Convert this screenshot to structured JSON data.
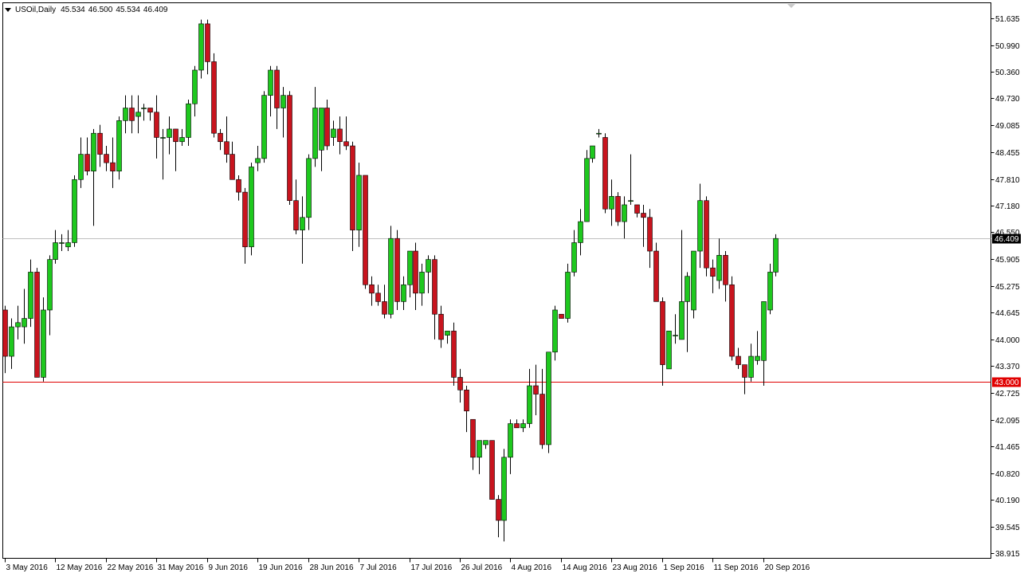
{
  "header": {
    "symbol": "USOil,Daily",
    "open": "45.534",
    "high": "46.500",
    "low": "45.534",
    "close": "46.409"
  },
  "colors": {
    "bull": "#1ec81e",
    "bear": "#c8141e",
    "wick": "#000000",
    "support_line": "#e00000",
    "last_price_line": "#c0c0c0",
    "label_bg": "#000000",
    "support_label_bg": "#e00000"
  },
  "chart_data": {
    "type": "candlestick",
    "ylim": [
      38.8,
      52.0
    ],
    "y_ticks": [
      "51.635",
      "50.990",
      "50.360",
      "49.730",
      "49.085",
      "48.455",
      "47.810",
      "47.180",
      "46.550",
      "45.905",
      "45.275",
      "44.645",
      "44.000",
      "43.370",
      "42.725",
      "42.095",
      "41.465",
      "40.820",
      "40.190",
      "39.545",
      "38.915"
    ],
    "x_ticks": [
      "3 May 2016",
      "12 May 2016",
      "22 May 2016",
      "31 May 2016",
      "9 Jun 2016",
      "19 Jun 2016",
      "28 Jun 2016",
      "7 Jul 2016",
      "17 Jul 2016",
      "26 Jul 2016",
      "4 Aug 2016",
      "14 Aug 2016",
      "23 Aug 2016",
      "1 Sep 2016",
      "11 Sep 2016",
      "20 Sep 2016"
    ],
    "current_price": "46.409",
    "support_level": "43.000",
    "candles": [
      {
        "o": 44.7,
        "h": 44.8,
        "l": 43.2,
        "c": 43.6
      },
      {
        "o": 43.6,
        "h": 44.5,
        "l": 43.3,
        "c": 44.3
      },
      {
        "o": 44.3,
        "h": 44.8,
        "l": 44.0,
        "c": 44.4
      },
      {
        "o": 44.3,
        "h": 45.2,
        "l": 43.9,
        "c": 44.5
      },
      {
        "o": 44.5,
        "h": 45.9,
        "l": 44.3,
        "c": 45.6
      },
      {
        "o": 45.6,
        "h": 45.7,
        "l": 43.1,
        "c": 43.1
      },
      {
        "o": 43.1,
        "h": 45.0,
        "l": 43.0,
        "c": 44.7
      },
      {
        "o": 44.7,
        "h": 46.0,
        "l": 44.1,
        "c": 45.9
      },
      {
        "o": 45.9,
        "h": 46.6,
        "l": 45.8,
        "c": 46.3
      },
      {
        "o": 46.3,
        "h": 46.5,
        "l": 46.1,
        "c": 46.3
      },
      {
        "o": 46.2,
        "h": 46.6,
        "l": 46.1,
        "c": 46.3
      },
      {
        "o": 46.3,
        "h": 47.9,
        "l": 46.2,
        "c": 47.8
      },
      {
        "o": 47.8,
        "h": 48.8,
        "l": 47.6,
        "c": 48.4
      },
      {
        "o": 48.4,
        "h": 48.8,
        "l": 47.9,
        "c": 48.0
      },
      {
        "o": 48.0,
        "h": 49.0,
        "l": 46.7,
        "c": 48.9
      },
      {
        "o": 48.9,
        "h": 49.1,
        "l": 48.1,
        "c": 48.4
      },
      {
        "o": 48.4,
        "h": 48.6,
        "l": 48.0,
        "c": 48.2
      },
      {
        "o": 48.2,
        "h": 48.8,
        "l": 47.6,
        "c": 48.0
      },
      {
        "o": 48.0,
        "h": 49.3,
        "l": 47.8,
        "c": 49.2
      },
      {
        "o": 49.2,
        "h": 49.8,
        "l": 48.9,
        "c": 49.5
      },
      {
        "o": 49.5,
        "h": 49.8,
        "l": 48.9,
        "c": 49.2
      },
      {
        "o": 49.3,
        "h": 49.8,
        "l": 48.9,
        "c": 49.4
      },
      {
        "o": 49.5,
        "h": 49.6,
        "l": 49.2,
        "c": 49.5
      },
      {
        "o": 49.5,
        "h": 49.5,
        "l": 49.2,
        "c": 49.4
      },
      {
        "o": 49.4,
        "h": 49.8,
        "l": 48.3,
        "c": 48.8
      },
      {
        "o": 48.8,
        "h": 49.0,
        "l": 47.8,
        "c": 48.8
      },
      {
        "o": 48.8,
        "h": 49.3,
        "l": 48.4,
        "c": 49.0
      },
      {
        "o": 49.0,
        "h": 49.0,
        "l": 48.0,
        "c": 48.7
      },
      {
        "o": 48.7,
        "h": 49.0,
        "l": 48.6,
        "c": 48.8
      },
      {
        "o": 48.8,
        "h": 49.7,
        "l": 48.6,
        "c": 49.6
      },
      {
        "o": 49.6,
        "h": 50.5,
        "l": 49.3,
        "c": 50.4
      },
      {
        "o": 50.4,
        "h": 51.6,
        "l": 50.2,
        "c": 51.5
      },
      {
        "o": 51.5,
        "h": 51.6,
        "l": 50.3,
        "c": 50.6
      },
      {
        "o": 50.6,
        "h": 50.8,
        "l": 48.8,
        "c": 48.9
      },
      {
        "o": 48.9,
        "h": 49.0,
        "l": 48.5,
        "c": 48.7
      },
      {
        "o": 48.7,
        "h": 49.3,
        "l": 48.2,
        "c": 48.4
      },
      {
        "o": 48.4,
        "h": 48.7,
        "l": 47.8,
        "c": 47.8
      },
      {
        "o": 47.8,
        "h": 47.9,
        "l": 47.3,
        "c": 47.5
      },
      {
        "o": 47.5,
        "h": 47.6,
        "l": 45.8,
        "c": 46.2
      },
      {
        "o": 46.2,
        "h": 48.2,
        "l": 46.0,
        "c": 48.1
      },
      {
        "o": 48.2,
        "h": 48.6,
        "l": 48.0,
        "c": 48.3
      },
      {
        "o": 48.3,
        "h": 49.9,
        "l": 48.2,
        "c": 49.8
      },
      {
        "o": 49.8,
        "h": 50.5,
        "l": 49.3,
        "c": 50.4
      },
      {
        "o": 50.4,
        "h": 50.5,
        "l": 49.0,
        "c": 49.5
      },
      {
        "o": 49.5,
        "h": 50.0,
        "l": 48.8,
        "c": 49.8
      },
      {
        "o": 49.8,
        "h": 49.9,
        "l": 47.2,
        "c": 47.3
      },
      {
        "o": 47.3,
        "h": 47.8,
        "l": 46.5,
        "c": 46.6
      },
      {
        "o": 46.6,
        "h": 47.4,
        "l": 45.8,
        "c": 46.9
      },
      {
        "o": 46.9,
        "h": 48.4,
        "l": 46.6,
        "c": 48.3
      },
      {
        "o": 48.3,
        "h": 50.0,
        "l": 48.1,
        "c": 49.5
      },
      {
        "o": 48.5,
        "h": 49.5,
        "l": 48.0,
        "c": 49.5
      },
      {
        "o": 49.5,
        "h": 49.7,
        "l": 48.5,
        "c": 48.6
      },
      {
        "o": 48.8,
        "h": 49.2,
        "l": 48.6,
        "c": 49.0
      },
      {
        "o": 49.0,
        "h": 49.3,
        "l": 48.4,
        "c": 48.7
      },
      {
        "o": 48.7,
        "h": 49.3,
        "l": 48.5,
        "c": 48.6
      },
      {
        "o": 48.6,
        "h": 48.7,
        "l": 46.1,
        "c": 46.6
      },
      {
        "o": 46.6,
        "h": 48.2,
        "l": 46.2,
        "c": 47.9
      },
      {
        "o": 47.9,
        "h": 47.9,
        "l": 45.2,
        "c": 45.3
      },
      {
        "o": 45.3,
        "h": 45.5,
        "l": 44.8,
        "c": 45.1
      },
      {
        "o": 45.1,
        "h": 45.3,
        "l": 44.8,
        "c": 44.9
      },
      {
        "o": 44.9,
        "h": 45.3,
        "l": 44.5,
        "c": 44.6
      },
      {
        "o": 44.6,
        "h": 46.7,
        "l": 44.5,
        "c": 46.4
      },
      {
        "o": 46.4,
        "h": 46.6,
        "l": 44.7,
        "c": 44.9
      },
      {
        "o": 44.9,
        "h": 45.5,
        "l": 44.7,
        "c": 45.3
      },
      {
        "o": 45.3,
        "h": 46.0,
        "l": 45.0,
        "c": 46.1
      },
      {
        "o": 46.1,
        "h": 46.3,
        "l": 44.7,
        "c": 45.1
      },
      {
        "o": 45.1,
        "h": 45.8,
        "l": 44.8,
        "c": 45.6
      },
      {
        "o": 45.6,
        "h": 46.0,
        "l": 45.1,
        "c": 45.9
      },
      {
        "o": 45.9,
        "h": 46.0,
        "l": 44.0,
        "c": 44.6
      },
      {
        "o": 44.6,
        "h": 44.8,
        "l": 43.8,
        "c": 44.0
      },
      {
        "o": 44.1,
        "h": 44.2,
        "l": 43.9,
        "c": 44.2
      },
      {
        "o": 44.2,
        "h": 44.4,
        "l": 42.9,
        "c": 43.1
      },
      {
        "o": 43.1,
        "h": 43.3,
        "l": 42.5,
        "c": 42.8
      },
      {
        "o": 42.8,
        "h": 42.9,
        "l": 41.8,
        "c": 42.3
      },
      {
        "o": 42.1,
        "h": 42.1,
        "l": 40.9,
        "c": 41.2
      },
      {
        "o": 41.2,
        "h": 41.6,
        "l": 40.8,
        "c": 41.6
      },
      {
        "o": 41.5,
        "h": 41.6,
        "l": 41.4,
        "c": 41.6
      },
      {
        "o": 41.6,
        "h": 41.6,
        "l": 40.2,
        "c": 40.2
      },
      {
        "o": 40.2,
        "h": 40.3,
        "l": 39.3,
        "c": 39.7
      },
      {
        "o": 39.7,
        "h": 41.4,
        "l": 39.2,
        "c": 41.2
      },
      {
        "o": 41.2,
        "h": 42.1,
        "l": 40.8,
        "c": 42.0
      },
      {
        "o": 42.0,
        "h": 42.1,
        "l": 41.9,
        "c": 41.9
      },
      {
        "o": 41.9,
        "h": 42.1,
        "l": 41.8,
        "c": 42.0
      },
      {
        "o": 42.0,
        "h": 43.3,
        "l": 41.9,
        "c": 42.9
      },
      {
        "o": 42.9,
        "h": 43.4,
        "l": 42.2,
        "c": 42.7
      },
      {
        "o": 42.7,
        "h": 43.3,
        "l": 41.4,
        "c": 41.5
      },
      {
        "o": 41.5,
        "h": 43.7,
        "l": 41.3,
        "c": 43.7
      },
      {
        "o": 43.7,
        "h": 44.8,
        "l": 43.5,
        "c": 44.7
      },
      {
        "o": 44.6,
        "h": 44.6,
        "l": 44.5,
        "c": 44.5
      },
      {
        "o": 44.5,
        "h": 45.8,
        "l": 44.4,
        "c": 45.6
      },
      {
        "o": 45.6,
        "h": 46.6,
        "l": 45.5,
        "c": 46.3
      },
      {
        "o": 46.3,
        "h": 47.1,
        "l": 46.0,
        "c": 46.8
      },
      {
        "o": 46.8,
        "h": 48.5,
        "l": 46.8,
        "c": 48.3
      },
      {
        "o": 48.3,
        "h": 48.6,
        "l": 48.2,
        "c": 48.6
      },
      {
        "o": 48.9,
        "h": 49.0,
        "l": 48.8,
        "c": 48.9
      },
      {
        "o": 48.8,
        "h": 48.9,
        "l": 47.0,
        "c": 47.1
      },
      {
        "o": 47.1,
        "h": 47.8,
        "l": 46.7,
        "c": 47.4
      },
      {
        "o": 47.4,
        "h": 47.5,
        "l": 46.7,
        "c": 46.8
      },
      {
        "o": 46.8,
        "h": 47.4,
        "l": 46.4,
        "c": 47.2
      },
      {
        "o": 47.3,
        "h": 48.4,
        "l": 47.2,
        "c": 47.3
      },
      {
        "o": 47.2,
        "h": 47.2,
        "l": 46.9,
        "c": 47.0
      },
      {
        "o": 47.0,
        "h": 47.2,
        "l": 46.2,
        "c": 46.9
      },
      {
        "o": 46.9,
        "h": 47.1,
        "l": 45.7,
        "c": 46.1
      },
      {
        "o": 46.1,
        "h": 46.3,
        "l": 45.0,
        "c": 44.9
      },
      {
        "o": 44.9,
        "h": 45.0,
        "l": 42.9,
        "c": 43.4
      },
      {
        "o": 43.3,
        "h": 44.2,
        "l": 43.3,
        "c": 44.2
      },
      {
        "o": 44.1,
        "h": 44.6,
        "l": 43.9,
        "c": 44.1
      },
      {
        "o": 44.0,
        "h": 46.6,
        "l": 44.0,
        "c": 44.9
      },
      {
        "o": 44.9,
        "h": 45.6,
        "l": 43.7,
        "c": 45.5
      },
      {
        "o": 44.7,
        "h": 46.1,
        "l": 44.5,
        "c": 46.1
      },
      {
        "o": 46.1,
        "h": 47.7,
        "l": 45.7,
        "c": 47.3
      },
      {
        "o": 47.3,
        "h": 47.4,
        "l": 45.5,
        "c": 45.7
      },
      {
        "o": 45.7,
        "h": 45.9,
        "l": 45.1,
        "c": 45.5
      },
      {
        "o": 45.4,
        "h": 46.4,
        "l": 45.2,
        "c": 46.0
      },
      {
        "o": 46.0,
        "h": 46.1,
        "l": 44.9,
        "c": 45.3
      },
      {
        "o": 45.3,
        "h": 45.5,
        "l": 43.5,
        "c": 43.6
      },
      {
        "o": 43.6,
        "h": 43.8,
        "l": 43.3,
        "c": 43.4
      },
      {
        "o": 43.4,
        "h": 43.4,
        "l": 42.7,
        "c": 43.1
      },
      {
        "o": 43.1,
        "h": 43.9,
        "l": 43.0,
        "c": 43.6
      },
      {
        "o": 43.5,
        "h": 44.2,
        "l": 43.4,
        "c": 43.6
      },
      {
        "o": 43.5,
        "h": 44.9,
        "l": 42.9,
        "c": 44.9
      },
      {
        "o": 44.7,
        "h": 45.8,
        "l": 44.6,
        "c": 45.6
      },
      {
        "o": 45.6,
        "h": 46.5,
        "l": 45.5,
        "c": 46.4
      }
    ]
  }
}
